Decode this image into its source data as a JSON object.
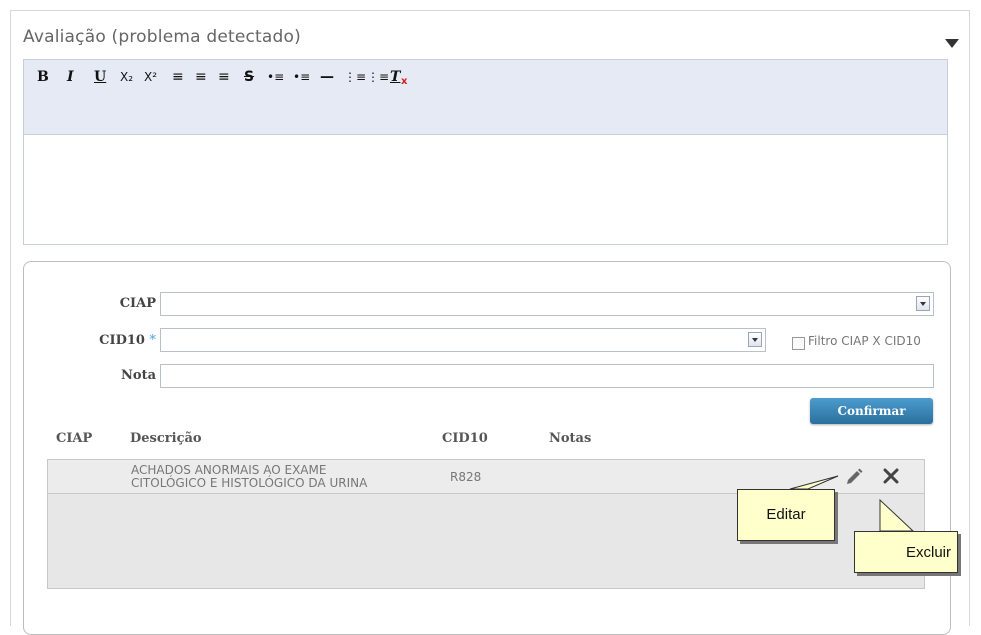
{
  "panel": {
    "title": "Avaliação (problema detectado)"
  },
  "toolbar": {
    "bold": "B",
    "italic": "I",
    "underline": "U",
    "subscript": "X₂",
    "superscript": "X²",
    "align_left": "≡",
    "align_center": "≡",
    "align_right": "≡",
    "strike": "S",
    "indent": "•≡",
    "outdent": "•≡",
    "hr": "—",
    "ordered_list": "⋮≡",
    "bullet_list": "⋮≡",
    "remove_format": "T"
  },
  "form": {
    "ciap_label": "CIAP",
    "ciap_value": "",
    "cid10_label": "CID10",
    "required_mark": "*",
    "cid10_value": "",
    "filter_label": "Filtro CIAP X CID10",
    "nota_label": "Nota",
    "nota_value": "",
    "confirm_label": "Confirmar"
  },
  "table": {
    "headers": [
      "CIAP",
      "Descrição",
      "CID10",
      "Notas"
    ],
    "rows": [
      {
        "ciap": "",
        "descricao_line1": "ACHADOS ANORMAIS AO EXAME",
        "descricao_line2": "CITOLÓGICO E HISTOLÓGICO DA URINA",
        "cid10": "R828",
        "notas": ""
      }
    ]
  },
  "callouts": {
    "edit": "Editar",
    "delete": "Excluir"
  },
  "colors": {
    "toolbar_bg": "#e6eaf4",
    "confirm_bg": "#2b6f9e",
    "callout_bg": "#ffffcc"
  }
}
